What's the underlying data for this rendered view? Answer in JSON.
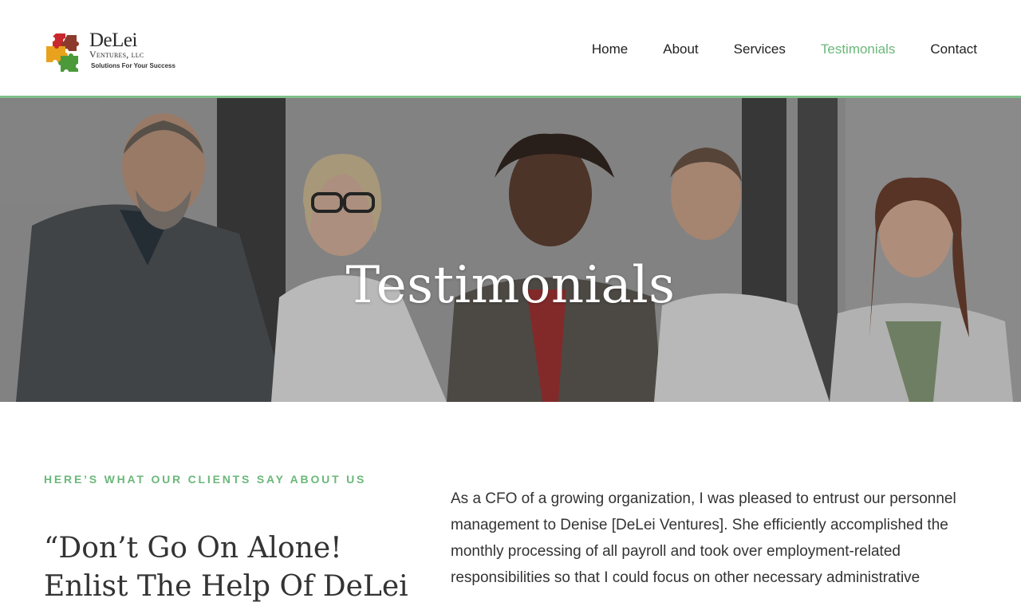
{
  "header": {
    "logo": {
      "main": "DeLei",
      "sub": "Ventures, llc",
      "tagline": "Solutions For Your Success",
      "puzzle_colors": [
        "#c8282d",
        "#8b3a2b",
        "#e8a21d",
        "#4a9a3a"
      ]
    },
    "nav": [
      {
        "label": "Home",
        "active": false
      },
      {
        "label": "About",
        "active": false
      },
      {
        "label": "Services",
        "active": false
      },
      {
        "label": "Testimonials",
        "active": true
      },
      {
        "label": "Contact",
        "active": false
      }
    ],
    "accent_color": "#6bb87a"
  },
  "hero": {
    "title": "Testimonials"
  },
  "content": {
    "eyebrow": "Here’s What Our Clients Say About Us",
    "quote_title": "“Don’t Go On Alone! Enlist The Help Of DeLei",
    "testimonial": "As a CFO of a growing organization, I was pleased to entrust our personnel management to Denise [DeLei Ventures]. She efficiently accomplished the monthly processing of all payroll and took over employment-related responsibilities so that I could focus on other necessary administrative"
  }
}
